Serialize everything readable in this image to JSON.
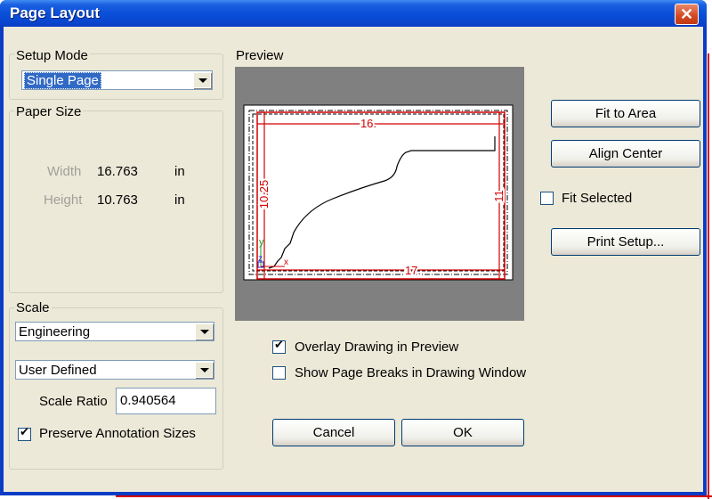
{
  "window": {
    "title": "Page Layout",
    "close_icon": "close-icon"
  },
  "setup_mode": {
    "label": "Setup Mode",
    "selected": "Single Page"
  },
  "paper_size": {
    "label": "Paper Size",
    "width_label": "Width",
    "width_value": "16.763",
    "width_unit": "in",
    "height_label": "Height",
    "height_value": "10.763",
    "height_unit": "in"
  },
  "scale": {
    "label": "Scale",
    "unit_system": "Engineering",
    "scale_type": "User Defined",
    "ratio_label": "Scale Ratio",
    "ratio_value": "0.940564",
    "preserve_label": "Preserve Annotation Sizes",
    "preserve_checked": true
  },
  "preview": {
    "label": "Preview",
    "dim_top": "16.",
    "dim_bottom": "17.",
    "dim_left": "10.25",
    "dim_right": "11",
    "axis_y": "y",
    "axis_z": "z",
    "axis_x": "x"
  },
  "buttons": {
    "fit_to_area": "Fit to Area",
    "align_center": "Align Center",
    "print_setup": "Print Setup...",
    "cancel": "Cancel",
    "ok": "OK"
  },
  "options": {
    "fit_selected": "Fit Selected",
    "overlay": "Overlay Drawing in Preview",
    "show_breaks": "Show Page Breaks in Drawing Window"
  },
  "colors": {
    "accent_red": "#d40000",
    "title_blue": "#0a4fd9",
    "dialog_bg": "#ece9d8"
  }
}
